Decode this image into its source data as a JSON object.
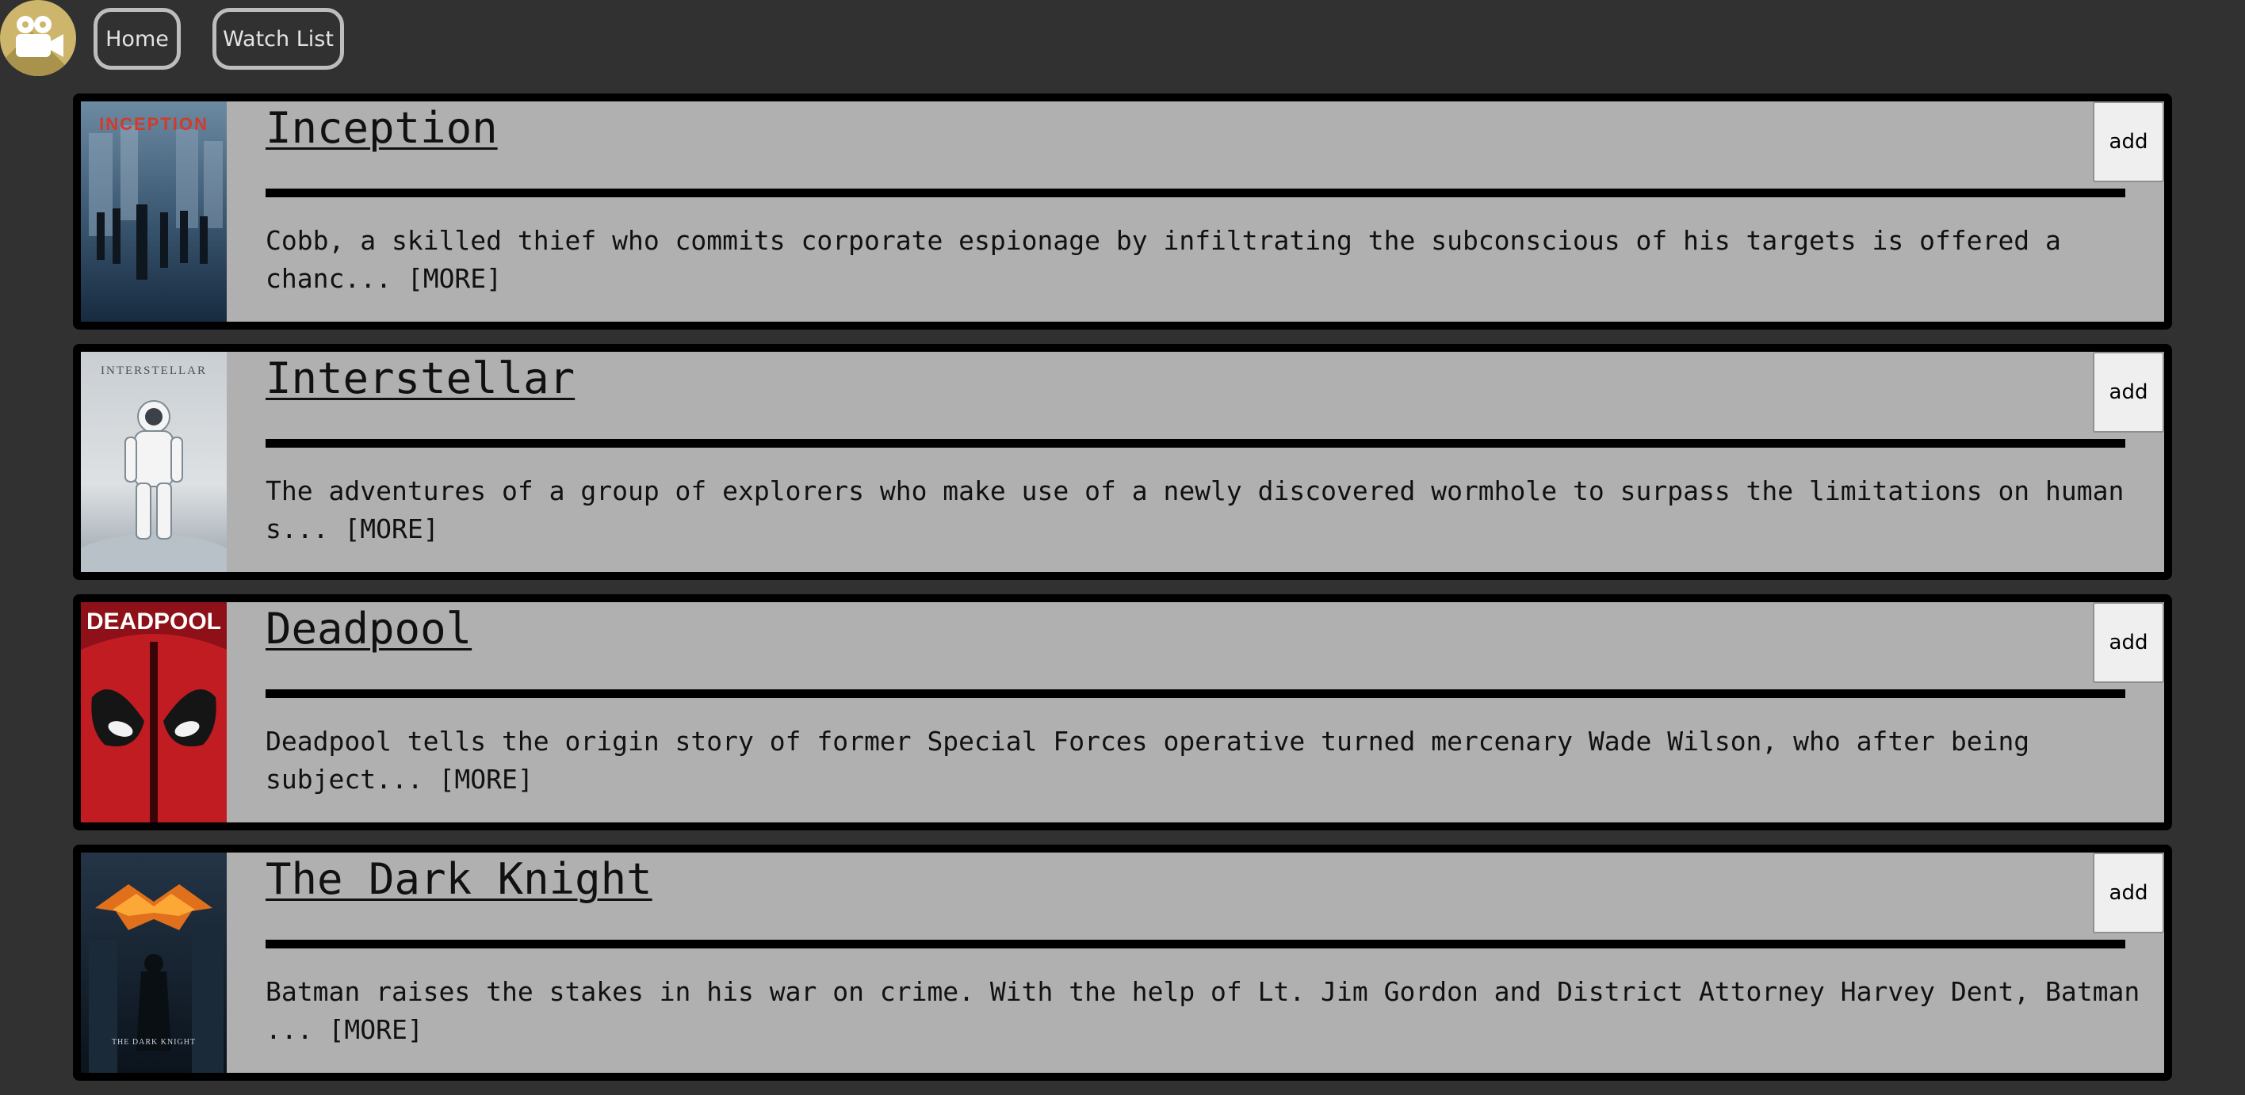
{
  "nav": {
    "logo_icon": "movie-camera-icon",
    "home_label": "Home",
    "watchlist_label": "Watch List"
  },
  "colors": {
    "background": "#313131",
    "card_background": "#b0b0b0",
    "logo": "#cdb66c"
  },
  "movies": [
    {
      "title": "Inception",
      "overview": "Cobb, a skilled thief who commits corporate espionage by infiltrating the subconscious of his targets is offered a chanc...",
      "more_label": "[MORE]",
      "add_label": "add",
      "poster_text": "INCEPTION"
    },
    {
      "title": "Interstellar",
      "overview": "The adventures of a group of explorers who make use of a newly discovered wormhole to surpass the limitations on human s...",
      "more_label": "[MORE]",
      "add_label": "add",
      "poster_text": "INTERSTELLAR"
    },
    {
      "title": "Deadpool",
      "overview": "Deadpool tells the origin story of former Special Forces operative turned mercenary Wade Wilson, who after being subject...",
      "more_label": "[MORE]",
      "add_label": "add",
      "poster_text": "DEADPOOL"
    },
    {
      "title": "The Dark Knight",
      "overview": "Batman raises the stakes in his war on crime. With the help of Lt. Jim Gordon and District Attorney Harvey Dent, Batman ...",
      "more_label": "[MORE]",
      "add_label": "add",
      "poster_text": "THE DARK KNIGHT"
    }
  ]
}
